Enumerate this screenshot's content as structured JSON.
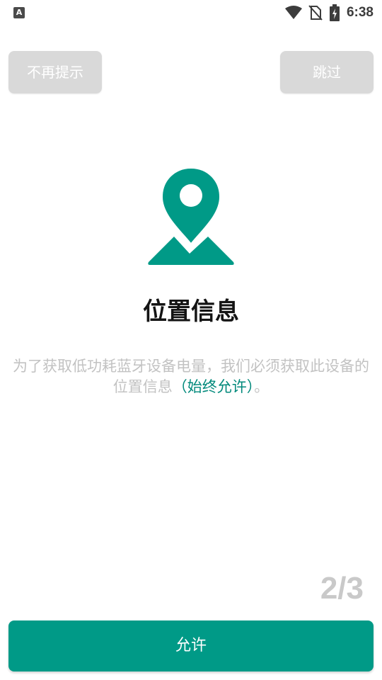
{
  "status_bar": {
    "time": "6:38",
    "left_icon": "A",
    "icons": [
      "wifi-icon",
      "no-sim-icon",
      "battery-charging-icon"
    ]
  },
  "top_bar": {
    "no_remind_label": "不再提示",
    "skip_label": "跳过"
  },
  "main": {
    "icon": "location-map-icon",
    "title": "位置信息",
    "description_prefix": "为了获取低功耗蓝牙设备电量，我们必须获取此设备的位置信息",
    "description_highlight": "（始终允许）",
    "description_suffix": "。"
  },
  "page_indicator": "2/3",
  "allow_button_label": "允许",
  "colors": {
    "accent": "#009a87",
    "highlight_text": "#00897b",
    "muted_text": "#c2c2c2",
    "top_button_bg": "#d9d9d9"
  }
}
